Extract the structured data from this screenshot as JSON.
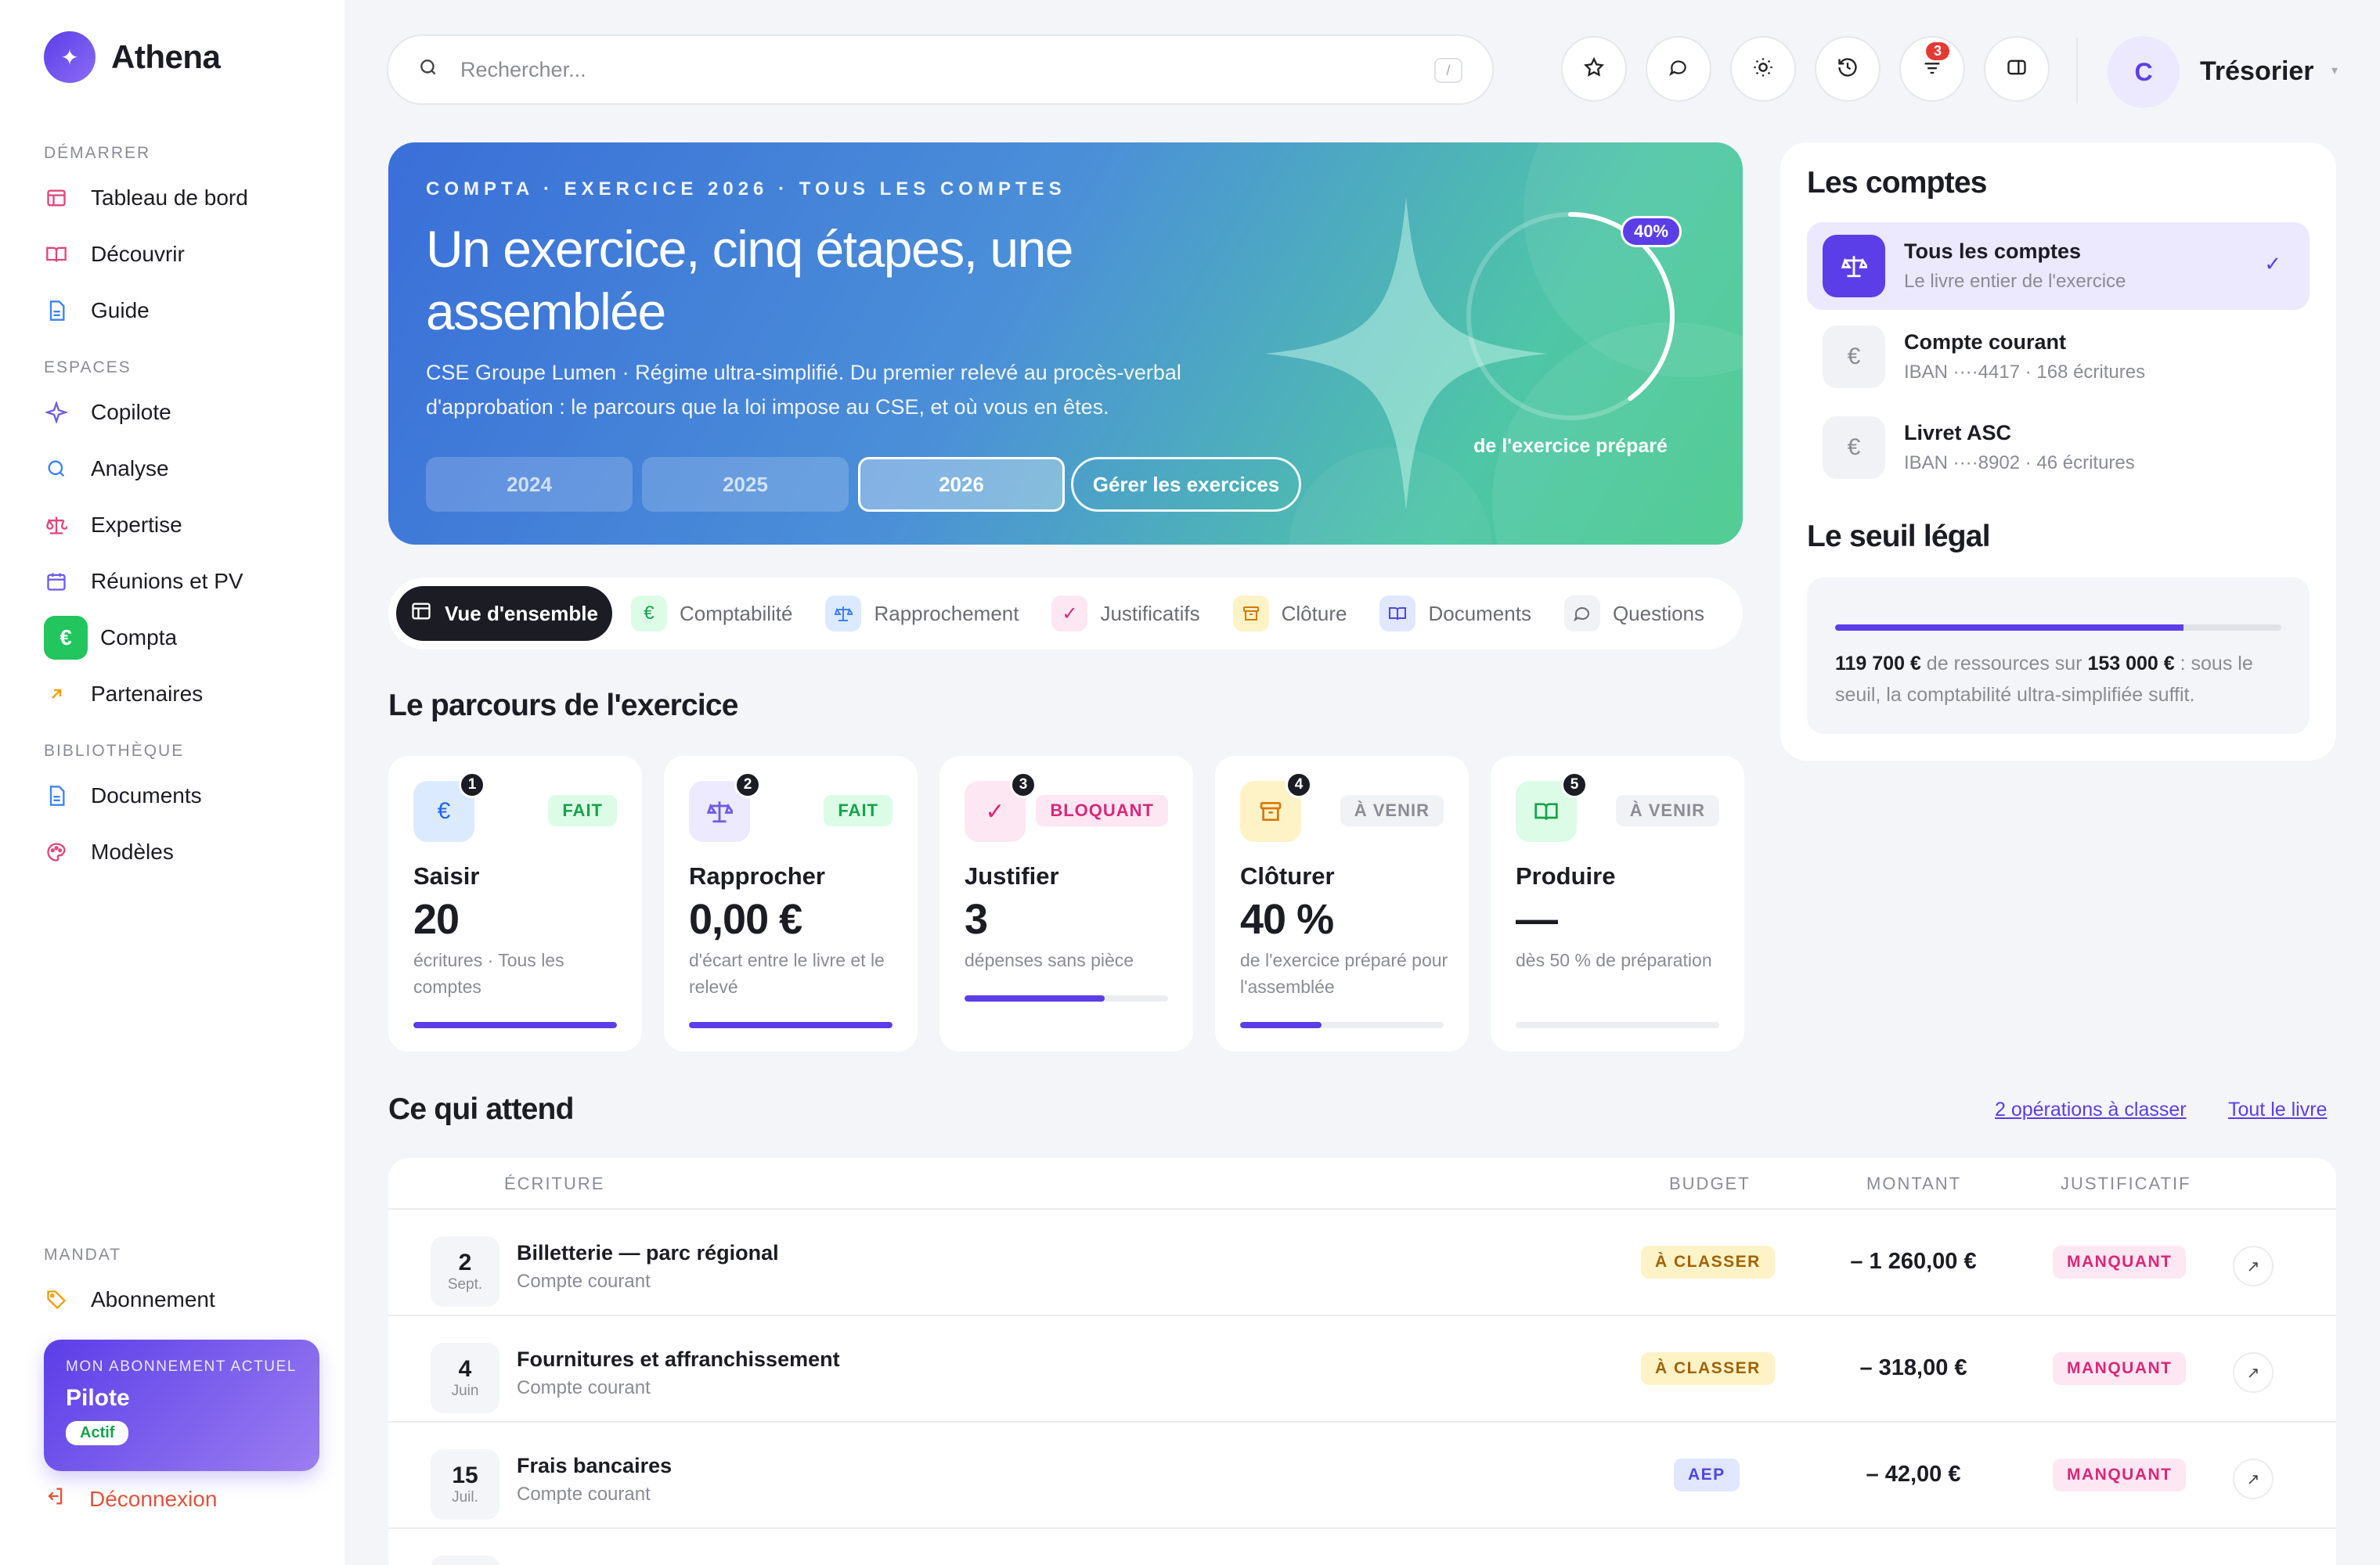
{
  "brand": {
    "name": "Athena",
    "logo_glyph": "✦"
  },
  "sidebar": {
    "sections": [
      {
        "label": "DÉMARRER"
      },
      {
        "label": "ESPACES"
      },
      {
        "label": "BIBLIOTHÈQUE"
      },
      {
        "label": "MANDAT"
      }
    ],
    "items": [
      {
        "label": "Tableau de bord",
        "icon": "layout-icon"
      },
      {
        "label": "Découvrir",
        "icon": "book-icon"
      },
      {
        "label": "Guide",
        "icon": "document-icon"
      },
      {
        "label": "Copilote",
        "icon": "sparkle-icon"
      },
      {
        "label": "Analyse",
        "icon": "search-icon"
      },
      {
        "label": "Expertise",
        "icon": "scale-icon"
      },
      {
        "label": "Réunions et PV",
        "icon": "calendar-icon"
      },
      {
        "label": "Compta",
        "icon": "euro-icon",
        "glyph": "€"
      },
      {
        "label": "Partenaires",
        "icon": "arrow-up-right-icon"
      },
      {
        "label": "Documents",
        "icon": "document-icon"
      },
      {
        "label": "Modèles",
        "icon": "palette-icon"
      },
      {
        "label": "Abonnement",
        "icon": "tag-icon"
      }
    ],
    "plan": {
      "caption": "MON ABONNEMENT ACTUEL",
      "name": "Pilote",
      "status": "Actif"
    },
    "logout": "Déconnexion"
  },
  "topbar": {
    "search_placeholder": "Rechercher...",
    "search_shortcut": "/",
    "notifications_count": "3",
    "user_initial": "C",
    "user_name": "Trésorier"
  },
  "hero": {
    "eyebrow": "COMPTA · EXERCICE 2026 · TOUS LES COMPTES",
    "title": "Un exercice, cinq étapes, une assemblée",
    "description": "CSE Groupe Lumen · Régime ultra-simplifié. Du premier relevé au procès-verbal d'approbation : le parcours que la loi impose au CSE, et où vous en êtes.",
    "years": [
      "2024",
      "2025",
      "2026"
    ],
    "selected_year": "2026",
    "manage_label": "Gérer les exercices",
    "progress_label": "40%",
    "progress_value": 0.4,
    "progress_caption": "de l'exercice préparé"
  },
  "tabs": [
    {
      "label": "Vue d'ensemble",
      "icon": "layout-icon"
    },
    {
      "label": "Comptabilité",
      "icon": "euro-icon"
    },
    {
      "label": "Rapprochement",
      "icon": "scale-icon"
    },
    {
      "label": "Justificatifs",
      "icon": "check-icon"
    },
    {
      "label": "Clôture",
      "icon": "archive-icon"
    },
    {
      "label": "Documents",
      "icon": "book-open-icon"
    },
    {
      "label": "Questions",
      "icon": "chat-icon"
    }
  ],
  "journey": {
    "title": "Le parcours de l'exercice",
    "steps": [
      {
        "num": "1",
        "status": "FAIT",
        "name": "Saisir",
        "value": "20",
        "desc": "écritures · Tous les comptes",
        "progress": 1.0,
        "icon": "euro-icon"
      },
      {
        "num": "2",
        "status": "FAIT",
        "name": "Rapprocher",
        "value": "0,00 €",
        "desc": "d'écart entre le livre et le relevé",
        "progress": 1.0,
        "icon": "scale-icon"
      },
      {
        "num": "3",
        "status": "BLOQUANT",
        "name": "Justifier",
        "value": "3",
        "desc": "dépenses sans pièce",
        "progress": 0.69,
        "icon": "check-icon"
      },
      {
        "num": "4",
        "status": "À VENIR",
        "name": "Clôturer",
        "value": "40 %",
        "desc": "de l'exercice préparé pour l'assemblée",
        "progress": 0.4,
        "icon": "archive-icon"
      },
      {
        "num": "5",
        "status": "À VENIR",
        "name": "Produire",
        "value": "—",
        "desc": "dès 50 % de préparation",
        "progress": 0,
        "icon": "book-open-icon"
      }
    ]
  },
  "pending": {
    "title": "Ce qui attend",
    "link_classify": "2 opérations à classer",
    "link_all": "Tout le livre",
    "columns": {
      "entry": "ÉCRITURE",
      "budget": "BUDGET",
      "amount": "MONTANT",
      "receipt": "JUSTIFICATIF"
    },
    "rows": [
      {
        "day": "2",
        "month": "Sept.",
        "name": "Billetterie — parc régional",
        "account": "Compte courant",
        "budget": "À CLASSER",
        "amount": "– 1 260,00 €",
        "receipt": "MANQUANT"
      },
      {
        "day": "4",
        "month": "Juin",
        "name": "Fournitures et affranchissement",
        "account": "Compte courant",
        "budget": "À CLASSER",
        "amount": "– 318,00 €",
        "receipt": "MANQUANT"
      },
      {
        "day": "15",
        "month": "Juil.",
        "name": "Frais bancaires",
        "account": "Compte courant",
        "budget": "AEP",
        "amount": "– 42,00 €",
        "receipt": "MANQUANT"
      }
    ]
  },
  "accounts": {
    "title": "Les comptes",
    "items": [
      {
        "name": "Tous les comptes",
        "sub": "Le livre entier de l'exercice",
        "icon": "scale-icon"
      },
      {
        "name": "Compte courant",
        "sub": "IBAN ····4417 · 168 écritures",
        "icon": "euro-icon"
      },
      {
        "name": "Livret ASC",
        "sub": "IBAN ····8902 · 46 écritures",
        "icon": "euro-icon"
      }
    ]
  },
  "threshold": {
    "title": "Le seuil légal",
    "resources": "119 700 €",
    "text_mid": "de ressources sur",
    "limit": "153 000 €",
    "text_end": ": sous le seuil, la comptabilité ultra-simplifiée suffit.",
    "ratio": 0.78
  },
  "colors": {
    "accent": "#5b3ee8",
    "success": "#22c55e",
    "danger": "#e53935"
  }
}
